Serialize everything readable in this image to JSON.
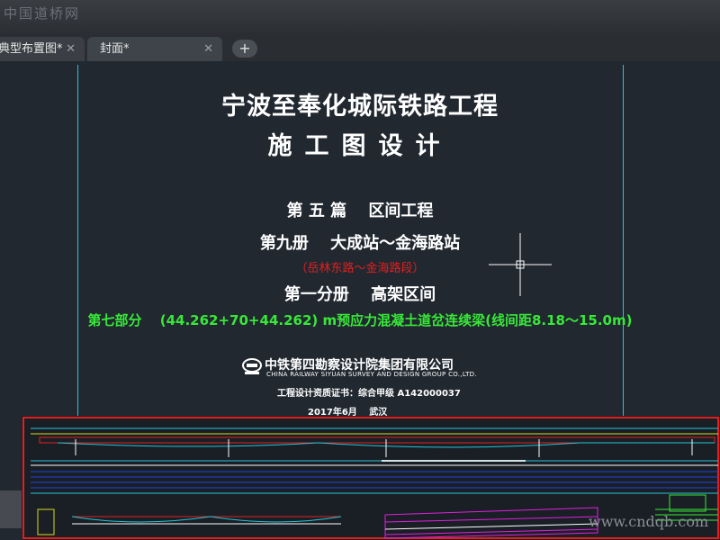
{
  "window": {
    "watermark_top": "中国道桥网",
    "watermark_bottom": "www.cndqb.com"
  },
  "tabs": [
    {
      "label": "典型布置图*",
      "close": "✕"
    },
    {
      "label": "封面*",
      "close": "✕"
    }
  ],
  "add_tab_label": "+",
  "cover": {
    "title": "宁波至奉化城际铁路工程",
    "subtitle": "施工图设计",
    "part": "第 五 篇　 区间工程",
    "volume": "第九册　 大成站～金海路站",
    "segment": "（岳林东路～金海路段）",
    "subvolume": "第一分册　 高架区间",
    "section": "第七部分　 (44.262+70+44.262) m预应力混凝土道岔连续梁(线间距8.18～15.0m)",
    "org_cn": "中铁第四勘察设计院集团有限公司",
    "org_en": "CHINA RAILWAY SIYUAN SURVEY AND DESIGN GROUP CO.,LTD.",
    "certificate": "工程设计资质证书：综合甲级 A142000037",
    "date_place": "2017年6月　 武汉"
  },
  "colors": {
    "frame": "#24c4d8",
    "segment_text": "#e02020",
    "section_text": "#38e838",
    "drawing_border": "#e02020"
  }
}
